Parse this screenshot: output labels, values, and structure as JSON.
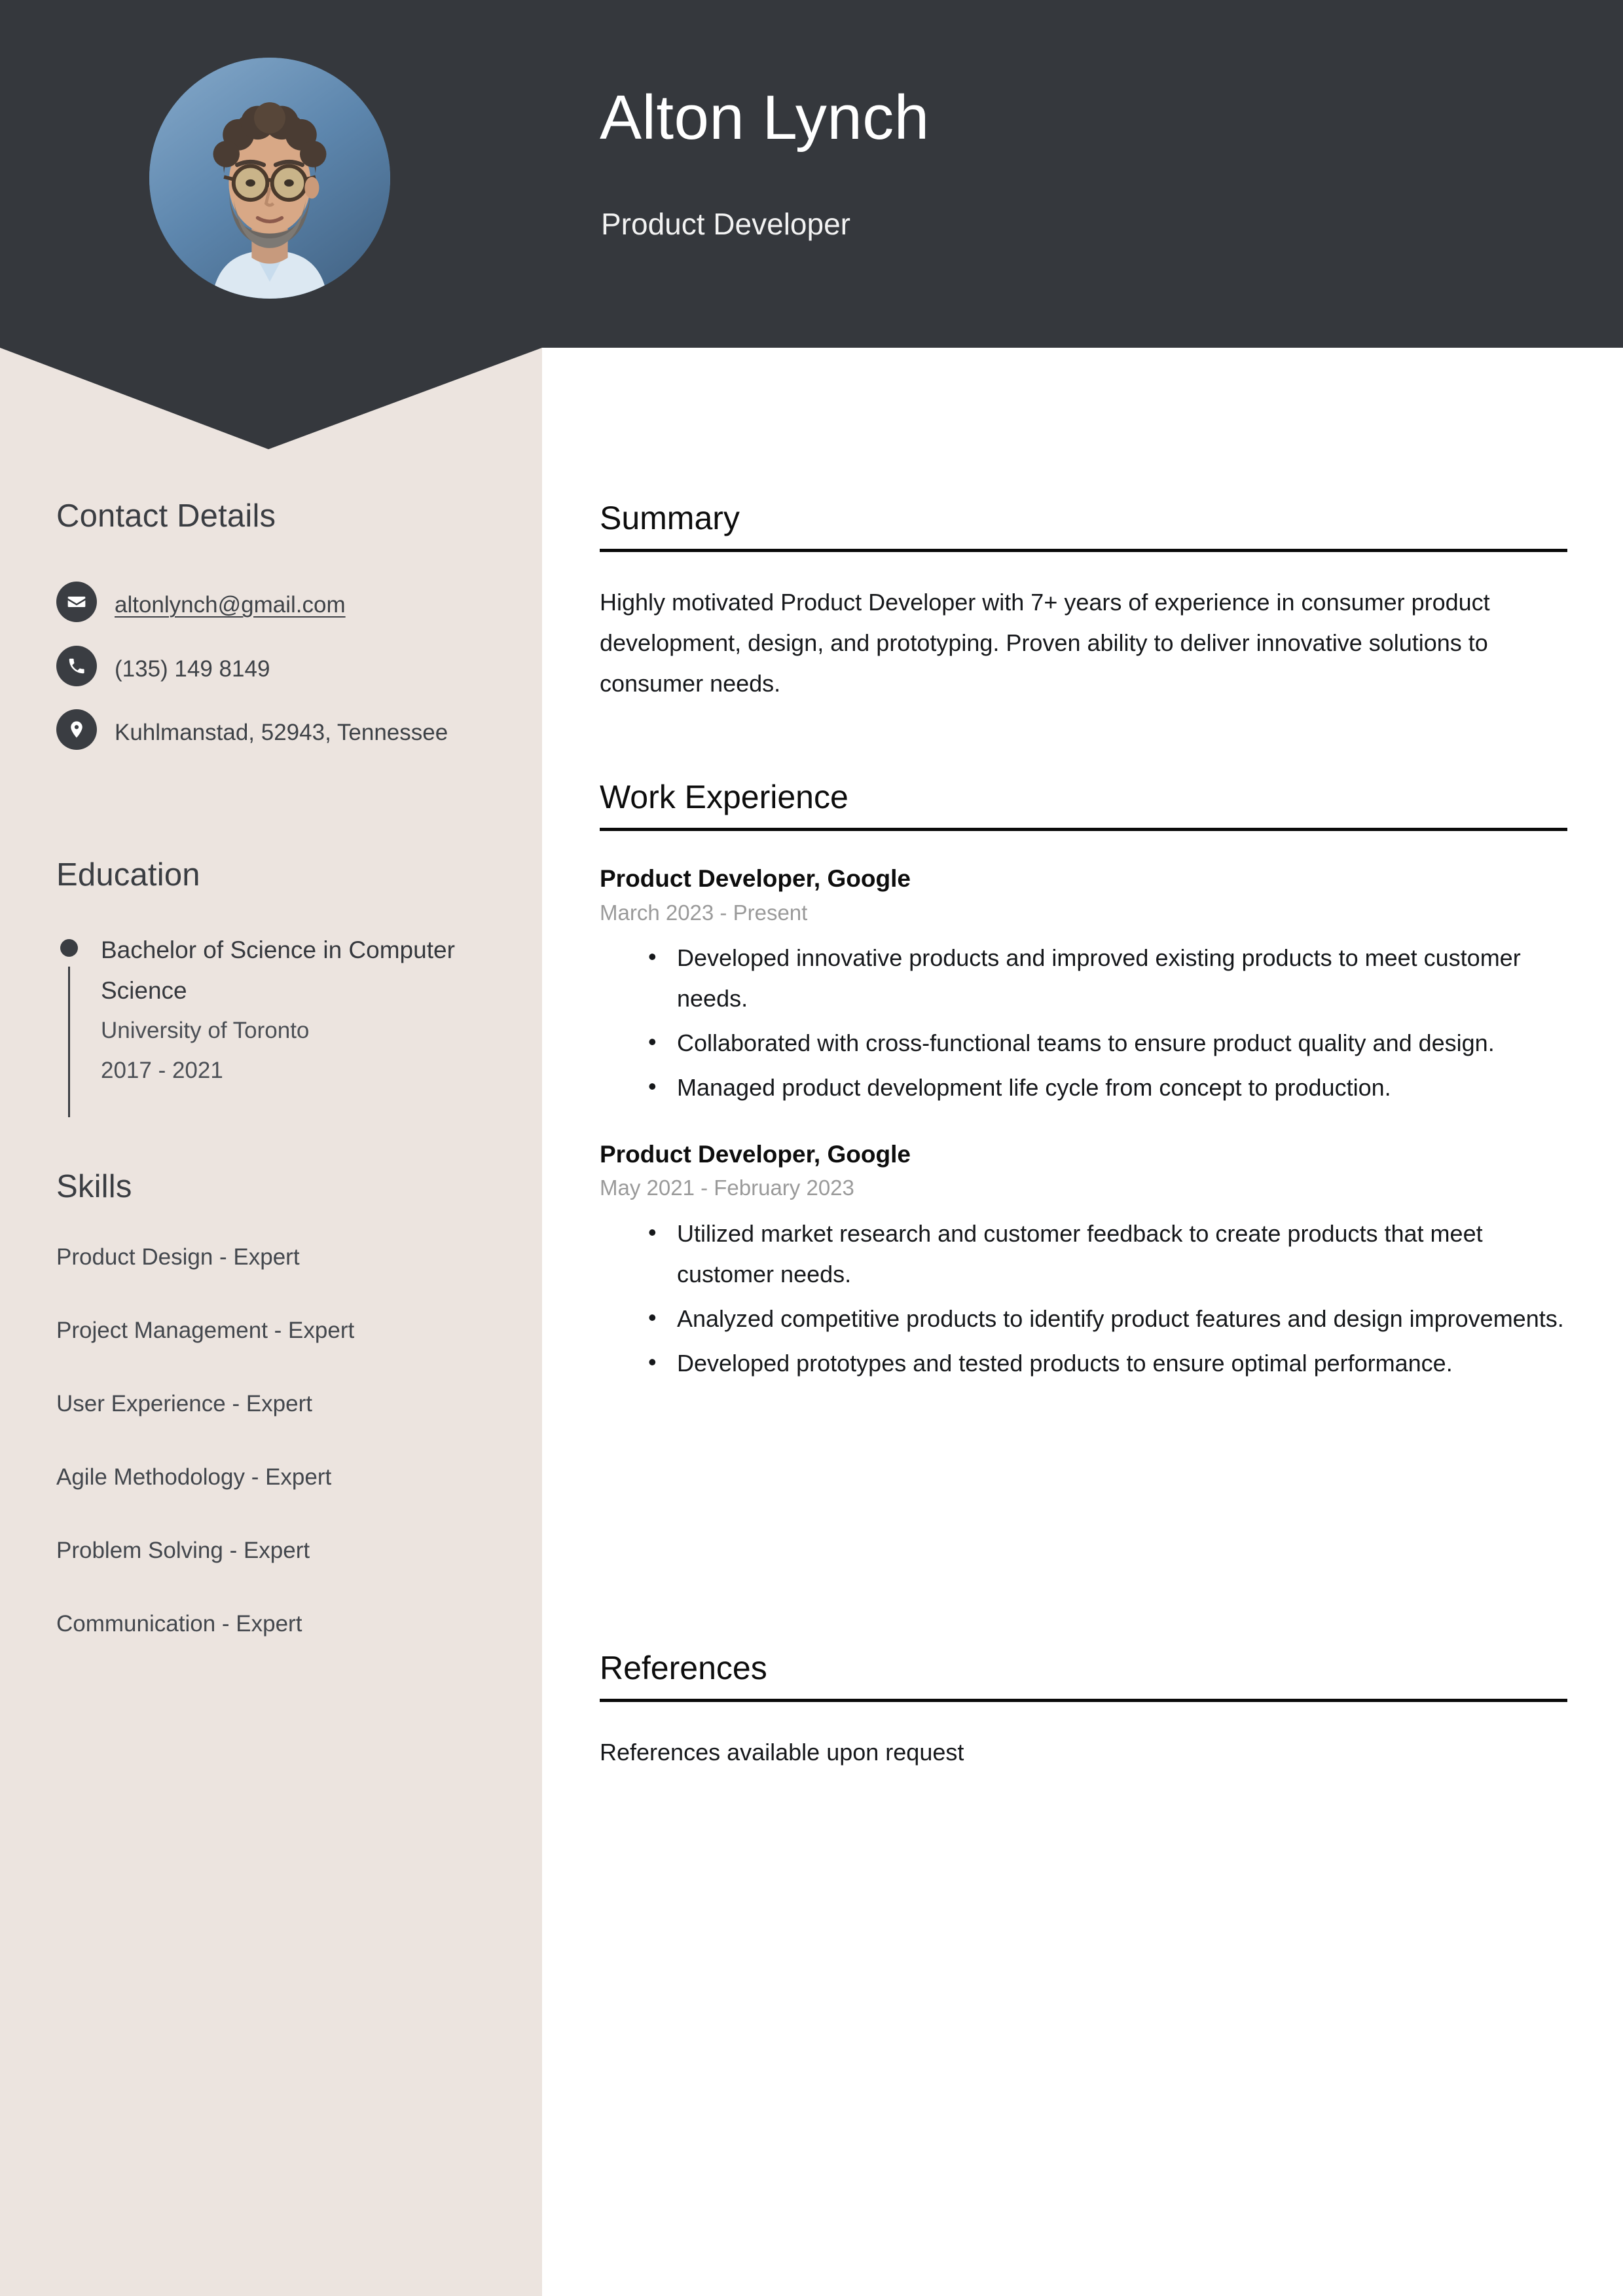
{
  "header": {
    "name": "Alton Lynch",
    "role": "Product Developer",
    "avatar_icon": "profile-photo",
    "background_color": "#35383d"
  },
  "sidebar": {
    "background_color": "#ece4df",
    "contact": {
      "heading": "Contact Details",
      "items": [
        {
          "icon": "envelope-icon",
          "value": "altonlynch@gmail.com",
          "type": "email"
        },
        {
          "icon": "phone-icon",
          "value": "(135) 149 8149",
          "type": "phone"
        },
        {
          "icon": "map-pin-icon",
          "value": "Kuhlmanstad, 52943, Tennessee",
          "type": "address"
        }
      ]
    },
    "education": {
      "heading": "Education",
      "entries": [
        {
          "degree": "Bachelor of Science in Computer Science",
          "school": "University of Toronto",
          "years": "2017 - 2021"
        }
      ]
    },
    "skills": {
      "heading": "Skills",
      "items": [
        "Product Design - Expert",
        "Project Management - Expert",
        "User Experience - Expert",
        "Agile Methodology - Expert",
        "Problem Solving - Expert",
        "Communication - Expert"
      ]
    }
  },
  "main": {
    "summary": {
      "heading": "Summary",
      "text": "Highly motivated Product Developer with 7+ years of experience in consumer product development, design, and prototyping. Proven ability to deliver innovative solutions to consumer needs."
    },
    "work_experience": {
      "heading": "Work Experience",
      "jobs": [
        {
          "title": "Product Developer, Google",
          "dates": "March 2023 - Present",
          "bullets": [
            "Developed innovative products and improved existing products to meet customer needs.",
            "Collaborated with cross-functional teams to ensure product quality and design.",
            "Managed product development life cycle from concept to production."
          ]
        },
        {
          "title": "Product Developer, Google",
          "dates": "May 2021 - February 2023",
          "bullets": [
            "Utilized market research and customer feedback to create products that meet customer needs.",
            "Analyzed competitive products to identify product features and design improvements.",
            "Developed prototypes and tested products to ensure optimal performance."
          ]
        }
      ]
    },
    "references": {
      "heading": "References",
      "text": "References available upon request"
    }
  }
}
